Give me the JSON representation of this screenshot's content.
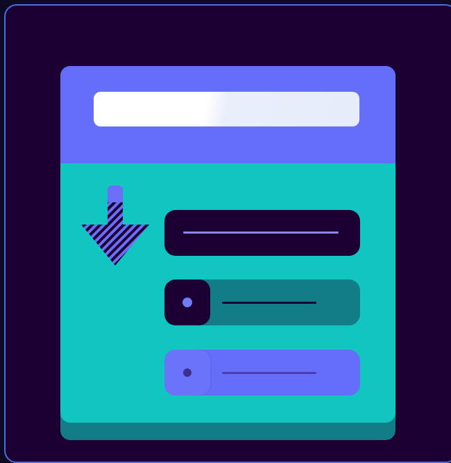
{
  "colors": {
    "background": "#1c0033",
    "frame_border": "#4f6ce0",
    "header": "#656ef8",
    "body": "#11c6c1",
    "body_shadow": "#127d86",
    "search_bar": "#ffffff",
    "row_dark": "#1c0033",
    "row_teal": "#127d86",
    "row_purple": "#656ef8"
  },
  "icons": {
    "sort_arrow": "arrow-down-icon",
    "toggle_on": "toggle-knob-icon",
    "toggle_off": "toggle-knob-icon"
  },
  "list": {
    "item_count": 3,
    "selected_index": 0
  }
}
